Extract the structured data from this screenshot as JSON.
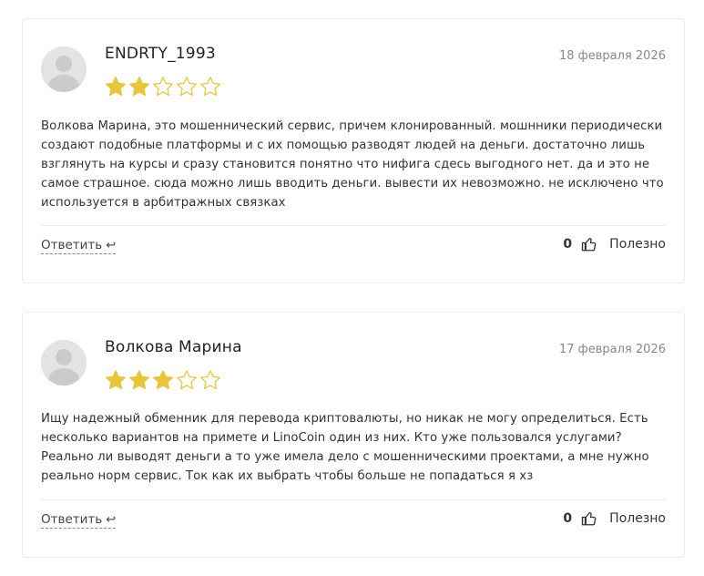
{
  "reviews": [
    {
      "author": "ENDRTY_1993",
      "date": "18 февраля 2026",
      "rating": 2,
      "max_rating": 5,
      "text": "Волкова Марина, это мошеннический сервис, причем клонированный. мошнники периодически создают подобные платформы и с их помощью разводят людей на деньги. достаточно лишь взглянуть на курсы и сразу становится понятно что нифига сдесь выгодного нет. да и это не самое страшное. сюда можно лишь вводить деньги. вывести их невозможно. не исключено что используется в арбитражных связках",
      "reply_label": "Ответить",
      "reply_icon": "↩",
      "useful_count": "0",
      "useful_label": "Полезно"
    },
    {
      "author": "Волкова Марина",
      "date": "17 февраля 2026",
      "rating": 3,
      "max_rating": 5,
      "text": "Ищу надежный обменник для перевода криптовалюты, но никак не могу определиться. Есть несколько вариантов на примете и LinoCoin один из них. Кто уже пользовался услугами? Реально ли выводят деньги а то уже имела дело с мошенническими проектами, а мне нужно реально норм сервис. Ток как их выбрать чтобы больше не попадаться я хз",
      "reply_label": "Ответить",
      "reply_icon": "↩",
      "useful_count": "0",
      "useful_label": "Полезно"
    }
  ],
  "colors": {
    "star_filled": "#e8c53a",
    "star_empty_stroke": "#e8c53a",
    "avatar_bg": "#e3e3e3",
    "avatar_fg": "#c9c9c9"
  },
  "icons": {
    "avatar": "user-avatar-icon",
    "star": "star-icon",
    "reply": "reply-arrow-icon",
    "like": "thumbs-up-icon"
  }
}
